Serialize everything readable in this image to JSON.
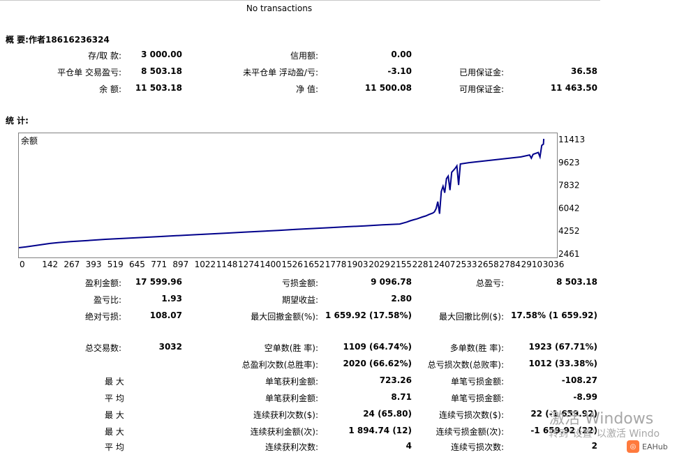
{
  "header": {
    "no_transactions": "No transactions"
  },
  "summary": {
    "title": "概 要:作者18616236324",
    "deposit_label": "存/取 款:",
    "deposit_value": "3 000.00",
    "credit_label": "信用额:",
    "credit_value": "0.00",
    "closed_pl_label": "平仓单 交易盈亏:",
    "closed_pl_value": "8 503.18",
    "floating_pl_label": "未平仓单 浮动盈/亏:",
    "floating_pl_value": "-3.10",
    "margin_label": "已用保证金:",
    "margin_value": "36.58",
    "balance_label": "余 额:",
    "balance_value": "11 503.18",
    "equity_label": "净 值:",
    "equity_value": "11 500.08",
    "free_margin_label": "可用保证金:",
    "free_margin_value": "11 463.50"
  },
  "stats_title": "统 计:",
  "chart_data": {
    "type": "line",
    "title": "余额",
    "series": [
      {
        "name": "余额",
        "color": "#00008b",
        "x": [
          0,
          40,
          100,
          180,
          230,
          300,
          400,
          500,
          600,
          700,
          800,
          900,
          1000,
          1100,
          1200,
          1300,
          1400,
          1500,
          1600,
          1700,
          1800,
          1900,
          2000,
          2100,
          2200,
          2240,
          2260,
          2280,
          2300,
          2330,
          2350,
          2370,
          2390,
          2400,
          2410,
          2420,
          2430,
          2440,
          2450,
          2460,
          2470,
          2480,
          2490,
          2500,
          2520,
          2530,
          2540,
          2550,
          2600,
          2700,
          2800,
          2900,
          2950,
          2960,
          2970,
          3000,
          3010,
          3020,
          3030,
          3032
        ],
        "y": [
          2900,
          2960,
          3080,
          3230,
          3300,
          3370,
          3460,
          3550,
          3620,
          3690,
          3760,
          3830,
          3900,
          3970,
          4040,
          4110,
          4180,
          4250,
          4330,
          4400,
          4470,
          4540,
          4600,
          4680,
          4750,
          4900,
          5000,
          5080,
          5150,
          5300,
          5380,
          5500,
          5600,
          5700,
          5950,
          6500,
          5550,
          7300,
          7700,
          7200,
          8300,
          8500,
          7400,
          8800,
          9100,
          9300,
          7800,
          9450,
          9550,
          9700,
          9850,
          10000,
          10150,
          9900,
          10200,
          10350,
          10000,
          10900,
          11000,
          11413
        ]
      }
    ],
    "y_ticks": [
      "11413",
      "9623",
      "7832",
      "6042",
      "4252",
      "2461"
    ],
    "x_ticks": [
      "0",
      "142",
      "267",
      "393",
      "519",
      "645",
      "771",
      "897",
      "1022",
      "1148",
      "1274",
      "1400",
      "1526",
      "1652",
      "1778",
      "1903",
      "2029",
      "2155",
      "2281",
      "2407",
      "2533",
      "2658",
      "2784",
      "2910",
      "3036"
    ],
    "ylim": [
      2461,
      11413
    ],
    "xlim": [
      0,
      3100
    ]
  },
  "stats": {
    "gross_profit_label": "盈利金额:",
    "gross_profit_value": "17 599.96",
    "gross_loss_label": "亏损金额:",
    "gross_loss_value": "9 096.78",
    "total_pl_label": "总盈亏:",
    "total_pl_value": "8 503.18",
    "profit_factor_label": "盈亏比:",
    "profit_factor_value": "1.93",
    "expected_payoff_label": "期望收益:",
    "expected_payoff_value": "2.80",
    "abs_drawdown_label": "绝对亏损:",
    "abs_drawdown_value": "108.07",
    "max_drawdown_label": "最大回撤金额(%):",
    "max_drawdown_value": "1 659.92 (17.58%)",
    "rel_drawdown_label": "最大回撤比例($):",
    "rel_drawdown_value": "17.58% (1 659.92)",
    "total_trades_label": "总交易数:",
    "total_trades_value": "3032",
    "short_label": "空单数(胜 率):",
    "short_value": "1109 (64.74%)",
    "long_label": "多单数(胜 率):",
    "long_value": "1923 (67.71%)",
    "profit_trades_label": "总盈利次数(总胜率):",
    "profit_trades_value": "2020 (66.62%)",
    "loss_trades_label": "总亏损次数(总败率):",
    "loss_trades_value": "1012 (33.38%)",
    "largest_label": "最 大",
    "largest_profit_label": "单笔获利金额:",
    "largest_profit_value": "723.26",
    "largest_loss_label": "单笔亏损金额:",
    "largest_loss_value": "-108.27",
    "average_label": "平 均",
    "avg_profit_label": "单笔获利金额:",
    "avg_profit_value": "8.71",
    "avg_loss_label": "单笔亏损金额:",
    "avg_loss_value": "-8.99",
    "max_label": "最 大",
    "max_consec_wins_label": "连续获利次数($):",
    "max_consec_wins_value": "24 (65.80)",
    "max_consec_losses_label": "连续亏损次数($):",
    "max_consec_losses_value": "22 (-1 659.92)",
    "max2_label": "最 大",
    "max_consec_profit_label": "连续获利金额(次):",
    "max_consec_profit_value": "1 894.74 (12)",
    "max_consec_loss_label": "连续亏损金额(次):",
    "max_consec_loss_value": "-1 659.92 (22)",
    "average2_label": "平 均",
    "avg_consec_wins_label": "连续获利次数:",
    "avg_consec_wins_value": "4",
    "avg_consec_losses_label": "连续亏损次数:",
    "avg_consec_losses_value": "2"
  },
  "watermark": {
    "line1": "激活 Windows",
    "line2": "转到\"设置\"以激活 Windo",
    "brand": "EAHub",
    "brand_icon": "eahub-logo-icon"
  }
}
